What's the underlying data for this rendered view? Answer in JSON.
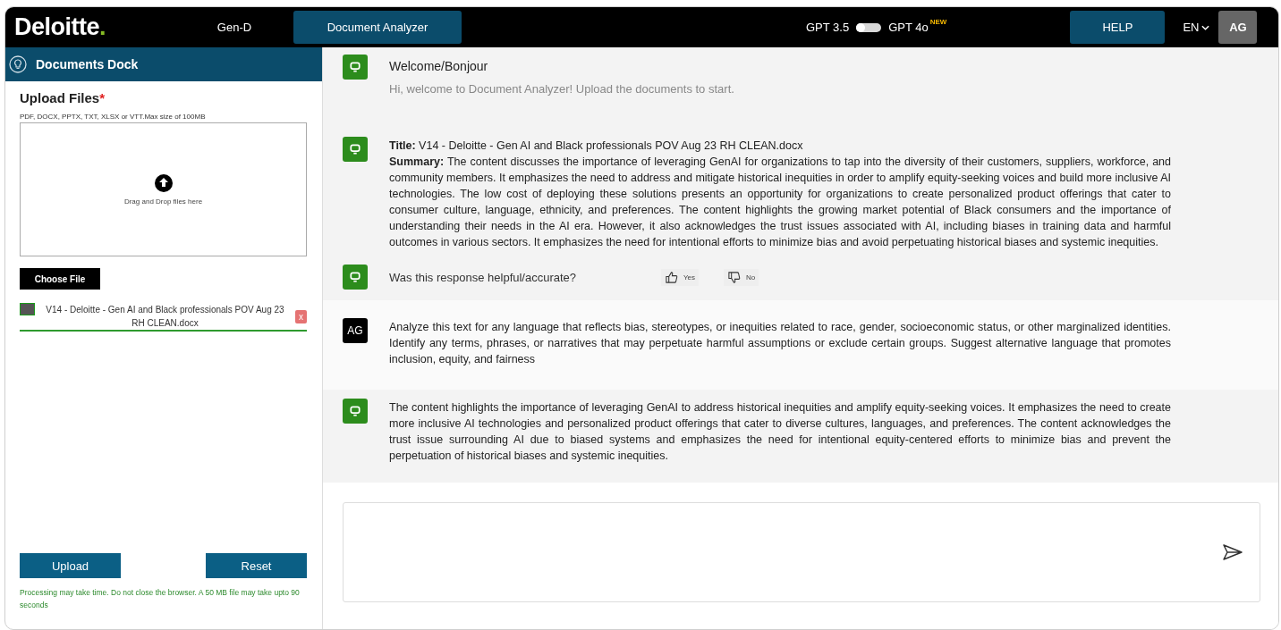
{
  "header": {
    "logo": "Deloitte",
    "logo_dot": ".",
    "nav": [
      {
        "label": "Gen-D",
        "selected": false
      },
      {
        "label": "Document Analyzer",
        "selected": true
      }
    ],
    "model_switch": {
      "left_label": "GPT 3.5",
      "right_label": "GPT 4o",
      "badge": "NEW",
      "on": false
    },
    "help": "HELP",
    "language": "EN",
    "avatar": "AG"
  },
  "sidebar": {
    "title": "Documents Dock",
    "upload_label": "Upload Files",
    "required_mark": "*",
    "hint": "PDF, DOCX, PPTX, TXT, XLSX or VTT.Max size of 100MB",
    "dropzone": "Drag and Drop files here",
    "choose_button": "Choose File",
    "files": [
      {
        "name": "V14 - Deloitte - Gen AI and Black professionals POV Aug 23 RH CLEAN.docx",
        "level": 1,
        "remove": "x"
      }
    ],
    "buttons": [
      "Upload",
      "Reset"
    ],
    "note": "Processing may take time. Do not close the browser. A 50 MB file may take upto 90 seconds"
  },
  "messages": [
    {
      "kind": "bot",
      "title": "Welcome/Bonjour",
      "text": "Hi, welcome to Document Analyzer! Upload the documents to start."
    },
    {
      "kind": "summary",
      "lines": [
        "**Title:** V14 - Deloitte - Gen AI and Black professionals POV Aug 23 RH CLEAN.docx",
        "**Summary:** The content discusses the importance of leveraging GenAI for organizations to tap into the diversity of their customers, suppliers, workforce, and community members. It emphasizes the need to address and mitigate historical inequities in order to amplify equity-seeking voices and build more inclusive AI technologies. The low cost of deploying these solutions presents an opportunity for organizations to create personalized product offerings that cater to consumer culture, language, ethnicity, and preferences. The content highlights the growing market potential of Black consumers and the importance of understanding their needs in the AI era. However, it also acknowledges the trust issues associated with AI, including biases in training data and harmful outcomes in various sectors. It emphasizes the need for intentional efforts to minimize bias and avoid perpetuating historical biases and systemic inequities."
      ]
    },
    {
      "kind": "feedback",
      "text": "Was this response helpful/accurate?",
      "yes": "Yes",
      "no": "No"
    },
    {
      "kind": "user",
      "avatar": "AG",
      "text": "Analyze this text for any language that reflects bias, stereotypes, or inequities related to race, gender, socioeconomic status, or other marginalized identities. Identify any terms, phrases, or narratives that may perpetuate harmful assumptions or exclude certain groups. Suggest alternative language that promotes inclusion, equity, and fairness"
    },
    {
      "kind": "answer",
      "text": "The content highlights the importance of leveraging GenAI to address historical inequities and amplify equity-seeking voices. It emphasizes the need to create more inclusive AI technologies and personalized product offerings that cater to diverse cultures, languages, and preferences. The content acknowledges the trust issue surrounding AI due to biased systems and emphasizes the need for intentional equity-centered efforts to minimize bias and prevent the perpetuation of historical biases and systemic inequities."
    }
  ]
}
